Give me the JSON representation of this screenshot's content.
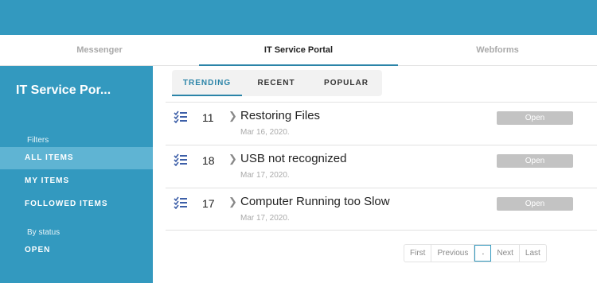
{
  "app_tabs": [
    {
      "label": "Messenger"
    },
    {
      "label": "IT Service Portal"
    },
    {
      "label": "Webforms"
    }
  ],
  "sidebar": {
    "title": "IT Service Por...",
    "filters_heading": "Filters",
    "items": [
      {
        "label": "ALL ITEMS"
      },
      {
        "label": "MY ITEMS"
      },
      {
        "label": "FOLLOWED ITEMS"
      }
    ],
    "status_heading": "By status",
    "status_items": [
      {
        "label": "OPEN"
      }
    ]
  },
  "view_tabs": [
    {
      "label": "TRENDING"
    },
    {
      "label": "RECENT"
    },
    {
      "label": "POPULAR"
    }
  ],
  "tickets": [
    {
      "number": "11",
      "title": "Restoring Files",
      "date": "Mar 16, 2020.",
      "status": "Open"
    },
    {
      "number": "18",
      "title": "USB not recognized",
      "date": "Mar 17, 2020.",
      "status": "Open"
    },
    {
      "number": "17",
      "title": "Computer Running too Slow",
      "date": "Mar 17, 2020.",
      "status": "Open"
    }
  ],
  "pager": {
    "first": "First",
    "previous": "Previous",
    "current": "·",
    "next": "Next",
    "last": "Last"
  },
  "colors": {
    "brand": "#3399bf",
    "accent": "#2b84a8",
    "status_badge": "#c3c3c3"
  }
}
